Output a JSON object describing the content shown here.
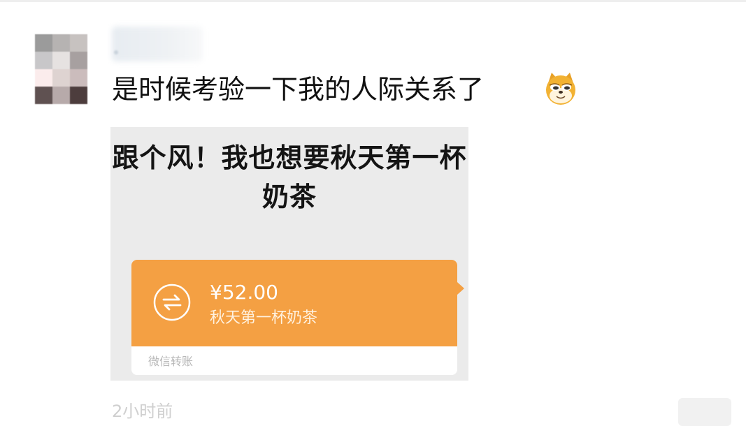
{
  "post": {
    "text": "是时候考验一下我的人际关系了",
    "emoji_icon": "doge-face-icon",
    "time": "2小时前"
  },
  "image": {
    "title": "跟个风！我也想要秋天第一杯奶茶",
    "transfer": {
      "amount": "¥52.00",
      "description": "秋天第一杯奶茶",
      "footer": "微信转账",
      "icon": "transfer-arrows-icon",
      "accent_color": "#f4a043"
    }
  },
  "colors": {
    "background": "#ffffff",
    "image_background": "#ebebeb",
    "transfer_orange": "#f4a043",
    "timestamp_gray": "#cfcfcf"
  }
}
